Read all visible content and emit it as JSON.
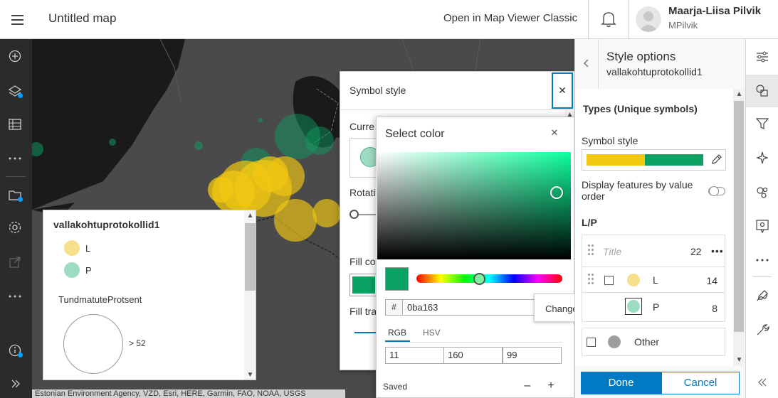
{
  "header": {
    "map_title": "Untitled map",
    "open_classic": "Open in Map Viewer Classic",
    "user_name": "Maarja-Liisa Pilvik",
    "user_id": "MPilvik"
  },
  "left_toolbar": {
    "icons": [
      "add-icon",
      "layers-icon",
      "table-icon",
      "more-icon",
      "folder-icon",
      "settings-icon",
      "share-icon",
      "more-icon",
      "info-icon",
      "expand-icon"
    ]
  },
  "map": {
    "attribution": "Estonian Environment Agency, VZD, Esri, HERE, Garmin, FAO, NOAA, USGS"
  },
  "legend": {
    "layer_title": "vallakohtuprotokollid1",
    "items": [
      {
        "label": "L",
        "color": "#f7e08c"
      },
      {
        "label": "P",
        "color": "#9edcc1"
      }
    ],
    "size_field": "TundmatuteProtsent",
    "size_label": "> 52"
  },
  "symbol_style": {
    "title": "Symbol style",
    "current_label": "Curre",
    "rotation_label": "Rotati",
    "fill_color_label": "Fill co",
    "fill_transparency_label": "Fill tra",
    "fill_color": "#0ba163"
  },
  "select_color": {
    "title": "Select color",
    "hash": "#",
    "hex": "0ba163",
    "tab_rgb": "RGB",
    "tab_hsv": "HSV",
    "r": "11",
    "g": "160",
    "b": "99",
    "saved_label": "Saved",
    "minus": "–",
    "plus": "+"
  },
  "tooltip": {
    "text": "Change symbol"
  },
  "style_panel": {
    "title": "Style options",
    "subtitle": "vallakohtuprotokollid1",
    "types_heading": "Types (Unique symbols)",
    "symbol_style_label": "Symbol style",
    "display_order_label": "Display features by value order",
    "field_label": "L/P",
    "title_placeholder": "Title",
    "title_count": "22",
    "more": "•••",
    "rows": [
      {
        "label": "L",
        "count": "14",
        "color": "#f7e08c"
      },
      {
        "label": "P",
        "count": "8",
        "color": "#9edcc1"
      }
    ],
    "other_label": "Other",
    "done": "Done",
    "cancel": "Cancel"
  },
  "colors": {
    "accent": "#007ac2",
    "yellow": "#f2c811",
    "green": "#0ba163"
  }
}
